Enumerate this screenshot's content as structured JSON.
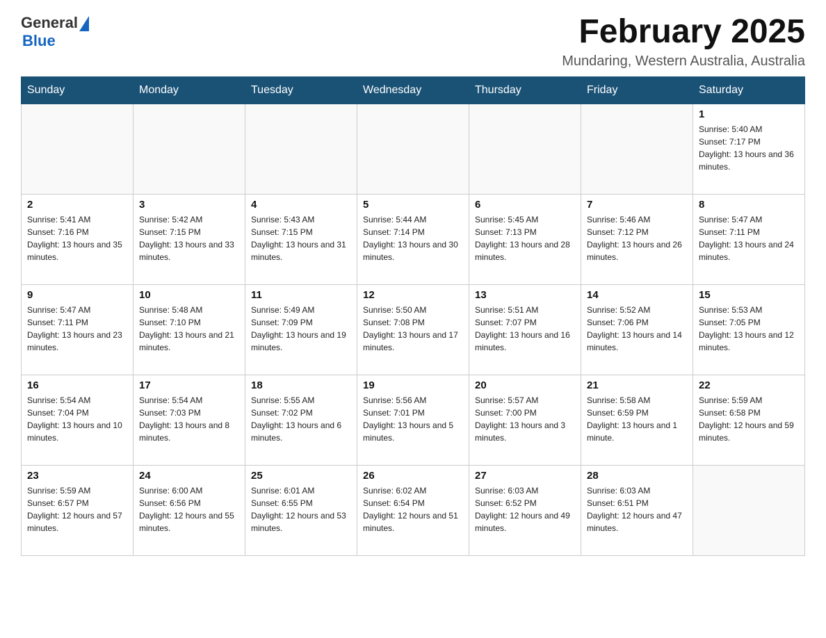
{
  "header": {
    "logo": {
      "general": "General",
      "blue": "Blue"
    },
    "title": "February 2025",
    "location": "Mundaring, Western Australia, Australia"
  },
  "weekdays": [
    "Sunday",
    "Monday",
    "Tuesday",
    "Wednesday",
    "Thursday",
    "Friday",
    "Saturday"
  ],
  "weeks": [
    [
      {
        "day": "",
        "info": ""
      },
      {
        "day": "",
        "info": ""
      },
      {
        "day": "",
        "info": ""
      },
      {
        "day": "",
        "info": ""
      },
      {
        "day": "",
        "info": ""
      },
      {
        "day": "",
        "info": ""
      },
      {
        "day": "1",
        "info": "Sunrise: 5:40 AM\nSunset: 7:17 PM\nDaylight: 13 hours and 36 minutes."
      }
    ],
    [
      {
        "day": "2",
        "info": "Sunrise: 5:41 AM\nSunset: 7:16 PM\nDaylight: 13 hours and 35 minutes."
      },
      {
        "day": "3",
        "info": "Sunrise: 5:42 AM\nSunset: 7:15 PM\nDaylight: 13 hours and 33 minutes."
      },
      {
        "day": "4",
        "info": "Sunrise: 5:43 AM\nSunset: 7:15 PM\nDaylight: 13 hours and 31 minutes."
      },
      {
        "day": "5",
        "info": "Sunrise: 5:44 AM\nSunset: 7:14 PM\nDaylight: 13 hours and 30 minutes."
      },
      {
        "day": "6",
        "info": "Sunrise: 5:45 AM\nSunset: 7:13 PM\nDaylight: 13 hours and 28 minutes."
      },
      {
        "day": "7",
        "info": "Sunrise: 5:46 AM\nSunset: 7:12 PM\nDaylight: 13 hours and 26 minutes."
      },
      {
        "day": "8",
        "info": "Sunrise: 5:47 AM\nSunset: 7:11 PM\nDaylight: 13 hours and 24 minutes."
      }
    ],
    [
      {
        "day": "9",
        "info": "Sunrise: 5:47 AM\nSunset: 7:11 PM\nDaylight: 13 hours and 23 minutes."
      },
      {
        "day": "10",
        "info": "Sunrise: 5:48 AM\nSunset: 7:10 PM\nDaylight: 13 hours and 21 minutes."
      },
      {
        "day": "11",
        "info": "Sunrise: 5:49 AM\nSunset: 7:09 PM\nDaylight: 13 hours and 19 minutes."
      },
      {
        "day": "12",
        "info": "Sunrise: 5:50 AM\nSunset: 7:08 PM\nDaylight: 13 hours and 17 minutes."
      },
      {
        "day": "13",
        "info": "Sunrise: 5:51 AM\nSunset: 7:07 PM\nDaylight: 13 hours and 16 minutes."
      },
      {
        "day": "14",
        "info": "Sunrise: 5:52 AM\nSunset: 7:06 PM\nDaylight: 13 hours and 14 minutes."
      },
      {
        "day": "15",
        "info": "Sunrise: 5:53 AM\nSunset: 7:05 PM\nDaylight: 13 hours and 12 minutes."
      }
    ],
    [
      {
        "day": "16",
        "info": "Sunrise: 5:54 AM\nSunset: 7:04 PM\nDaylight: 13 hours and 10 minutes."
      },
      {
        "day": "17",
        "info": "Sunrise: 5:54 AM\nSunset: 7:03 PM\nDaylight: 13 hours and 8 minutes."
      },
      {
        "day": "18",
        "info": "Sunrise: 5:55 AM\nSunset: 7:02 PM\nDaylight: 13 hours and 6 minutes."
      },
      {
        "day": "19",
        "info": "Sunrise: 5:56 AM\nSunset: 7:01 PM\nDaylight: 13 hours and 5 minutes."
      },
      {
        "day": "20",
        "info": "Sunrise: 5:57 AM\nSunset: 7:00 PM\nDaylight: 13 hours and 3 minutes."
      },
      {
        "day": "21",
        "info": "Sunrise: 5:58 AM\nSunset: 6:59 PM\nDaylight: 13 hours and 1 minute."
      },
      {
        "day": "22",
        "info": "Sunrise: 5:59 AM\nSunset: 6:58 PM\nDaylight: 12 hours and 59 minutes."
      }
    ],
    [
      {
        "day": "23",
        "info": "Sunrise: 5:59 AM\nSunset: 6:57 PM\nDaylight: 12 hours and 57 minutes."
      },
      {
        "day": "24",
        "info": "Sunrise: 6:00 AM\nSunset: 6:56 PM\nDaylight: 12 hours and 55 minutes."
      },
      {
        "day": "25",
        "info": "Sunrise: 6:01 AM\nSunset: 6:55 PM\nDaylight: 12 hours and 53 minutes."
      },
      {
        "day": "26",
        "info": "Sunrise: 6:02 AM\nSunset: 6:54 PM\nDaylight: 12 hours and 51 minutes."
      },
      {
        "day": "27",
        "info": "Sunrise: 6:03 AM\nSunset: 6:52 PM\nDaylight: 12 hours and 49 minutes."
      },
      {
        "day": "28",
        "info": "Sunrise: 6:03 AM\nSunset: 6:51 PM\nDaylight: 12 hours and 47 minutes."
      },
      {
        "day": "",
        "info": ""
      }
    ]
  ]
}
